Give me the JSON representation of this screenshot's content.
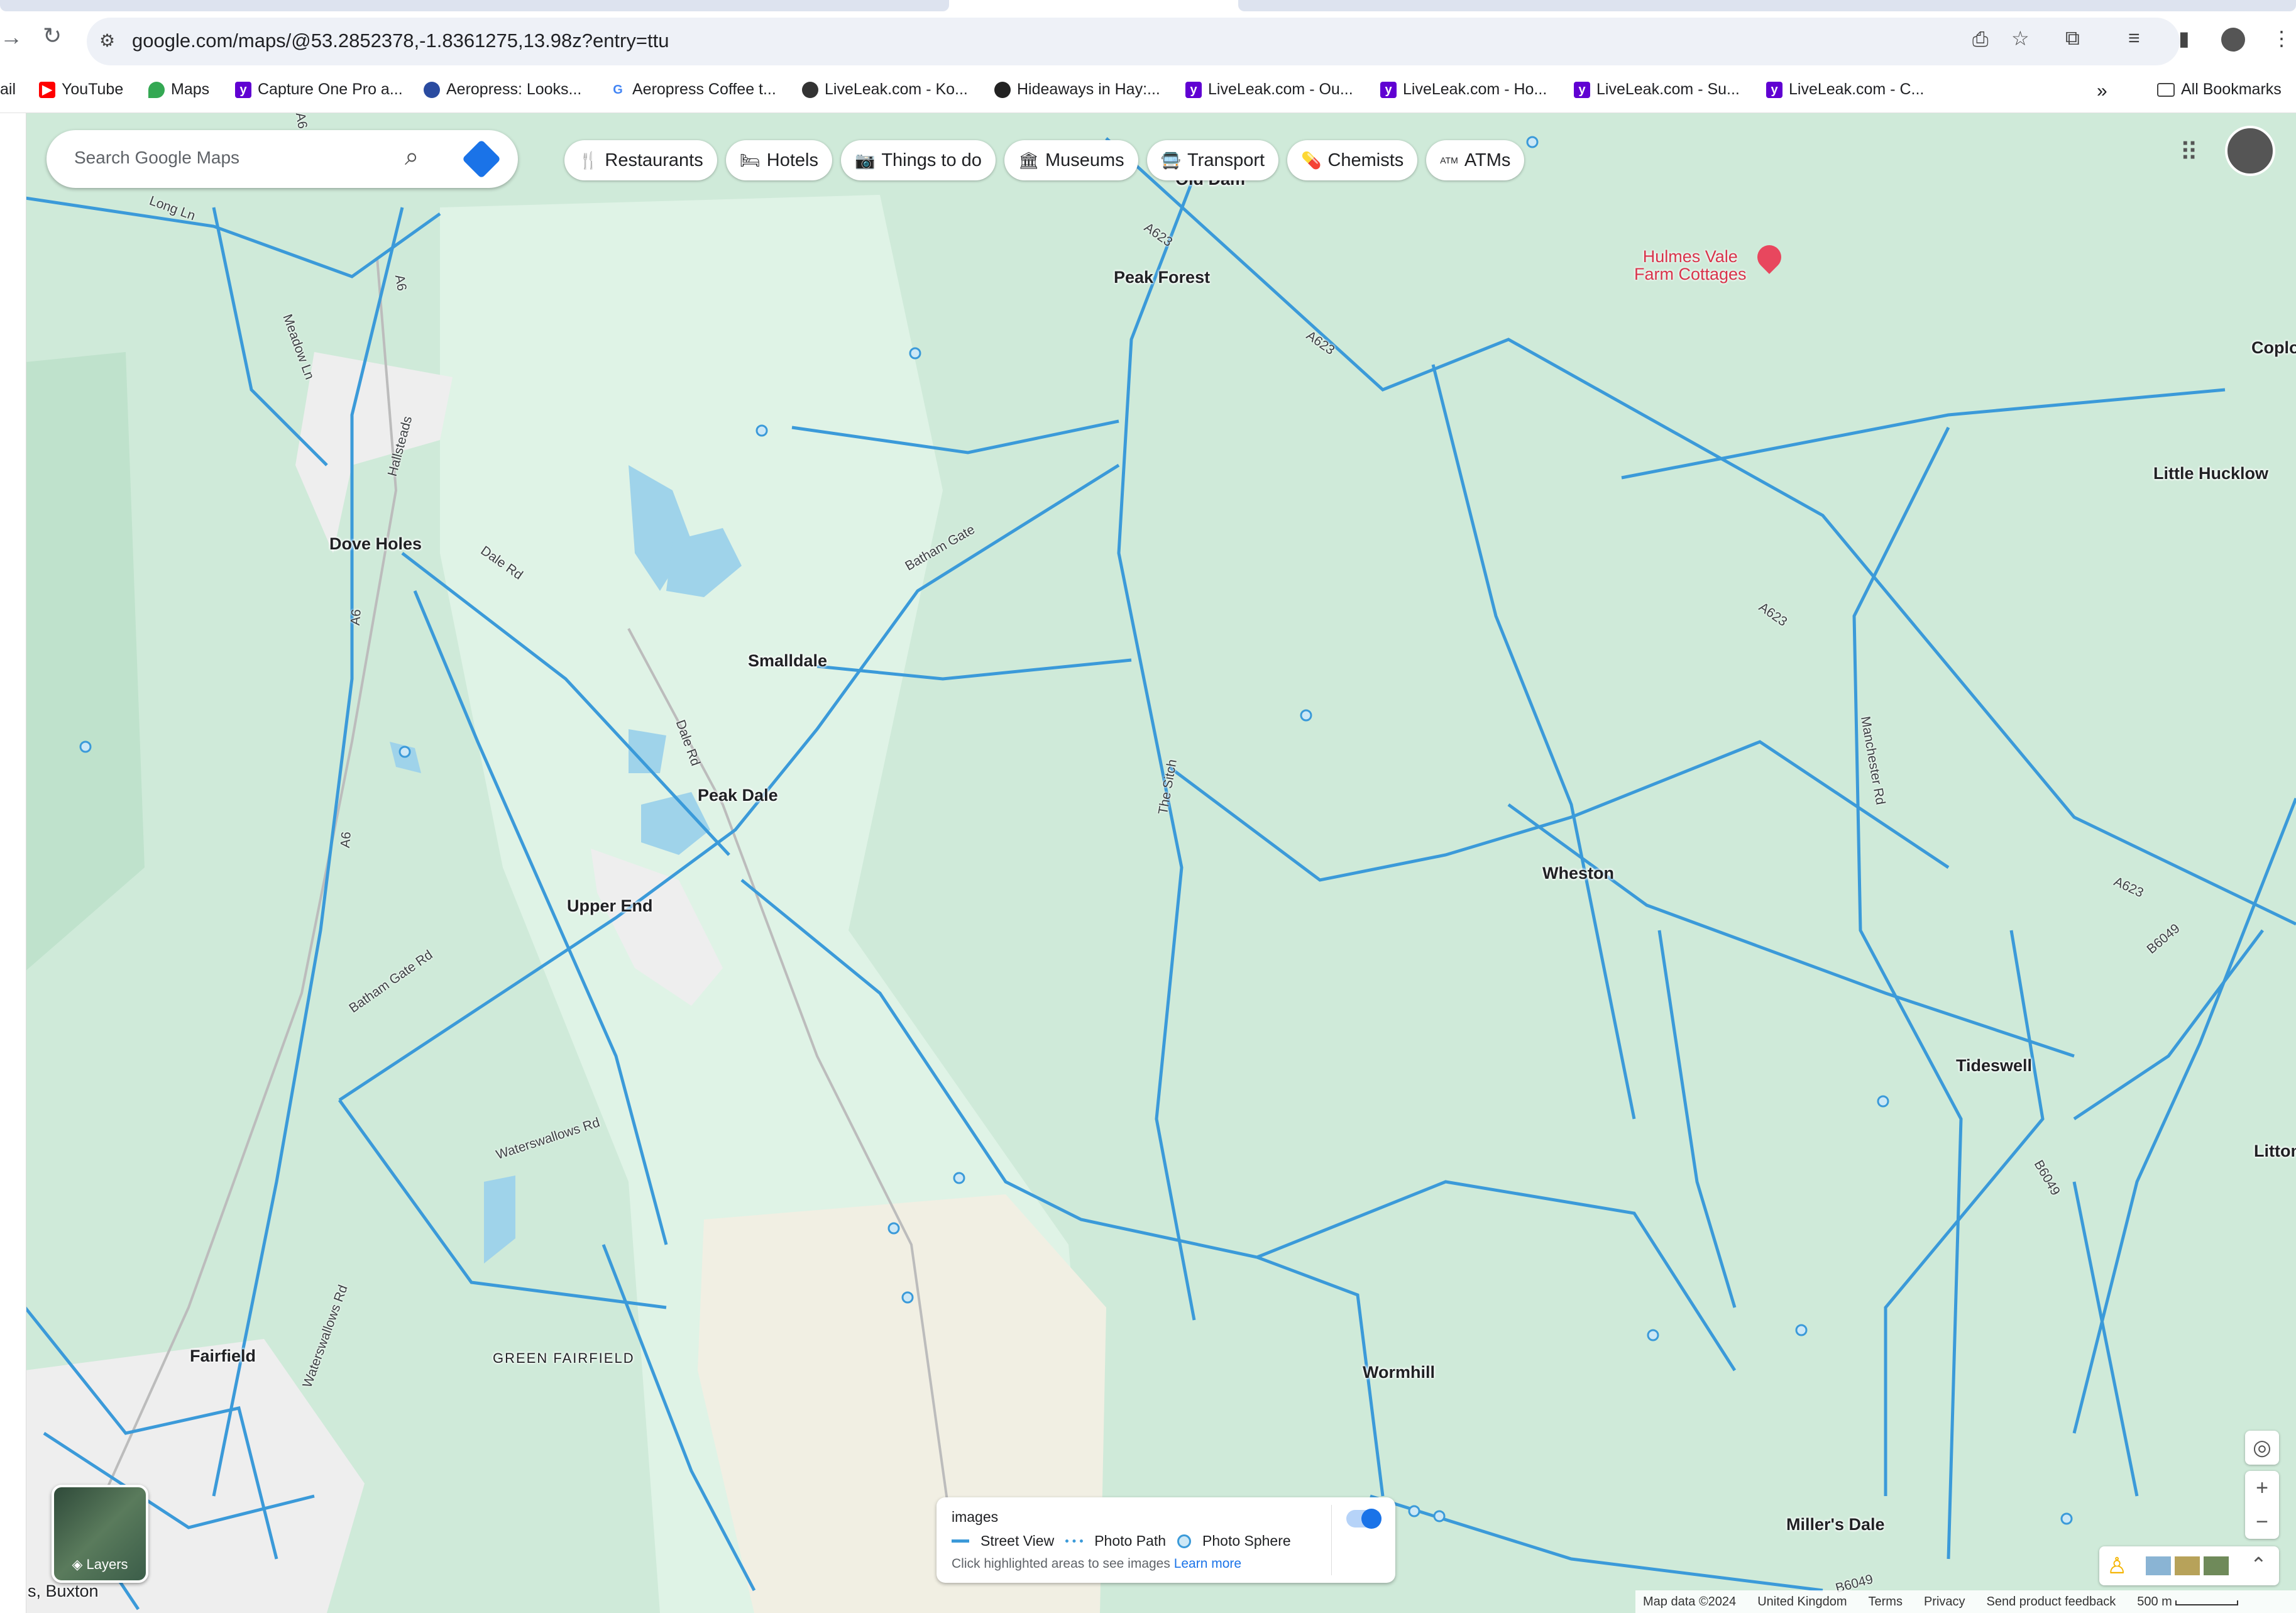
{
  "browser": {
    "url": "google.com/maps/@53.2852378,-1.8361275,13.98z?entry=ttu",
    "nav_forward_icon": "arrow-right",
    "reload_icon": "reload"
  },
  "bookmarks": {
    "items": [
      {
        "label": "ail",
        "icon": "truncated"
      },
      {
        "label": "YouTube",
        "icon": "youtube-icon",
        "color": "#ff0000"
      },
      {
        "label": "Maps",
        "icon": "maps-pin-icon",
        "color": "#34a853"
      },
      {
        "label": "Capture One Pro a...",
        "icon": "yahoo-icon",
        "color": "#6001d2"
      },
      {
        "label": "Aeropress: Looks...",
        "icon": "aeropress-icon",
        "color": "#2a4ba0"
      },
      {
        "label": "Aeropress Coffee t...",
        "icon": "google-icon",
        "color": "#4285f4"
      },
      {
        "label": "LiveLeak.com - Ko...",
        "icon": "liveleak-icon",
        "color": "#333333"
      },
      {
        "label": "Hideaways in Hay:...",
        "icon": "hideaways-icon",
        "color": "#222222"
      },
      {
        "label": "LiveLeak.com - Ou...",
        "icon": "yahoo-icon",
        "color": "#6001d2"
      },
      {
        "label": "LiveLeak.com - Ho...",
        "icon": "yahoo-icon",
        "color": "#6001d2"
      },
      {
        "label": "LiveLeak.com - Su...",
        "icon": "yahoo-icon",
        "color": "#6001d2"
      },
      {
        "label": "LiveLeak.com - C...",
        "icon": "yahoo-icon",
        "color": "#6001d2"
      }
    ],
    "overflow": "»",
    "all_bookmarks": "All Bookmarks"
  },
  "search": {
    "placeholder": "Search Google Maps"
  },
  "chips": [
    {
      "label": "Restaurants",
      "icon": "fork-knife-icon",
      "glyph": "🍴"
    },
    {
      "label": "Hotels",
      "icon": "bed-icon",
      "glyph": "🛏"
    },
    {
      "label": "Things to do",
      "icon": "camera-icon",
      "glyph": "📷"
    },
    {
      "label": "Museums",
      "icon": "museum-icon",
      "glyph": "🏛"
    },
    {
      "label": "Transport",
      "icon": "bus-icon",
      "glyph": "🚍"
    },
    {
      "label": "Chemists",
      "icon": "pharmacy-icon",
      "glyph": "💊"
    },
    {
      "label": "ATMs",
      "icon": "atm-icon",
      "glyph": "ATM"
    }
  ],
  "places": {
    "dove_holes": "Dove Holes",
    "peak_forest": "Peak Forest",
    "old_dam": "Old Dam",
    "smalldale": "Smalldale",
    "peak_dale": "Peak Dale",
    "upper_end": "Upper End",
    "wheston": "Wheston",
    "tideswell": "Tideswell",
    "little_hucklow": "Little Hucklow",
    "coplow": "Coplo",
    "litton": "Litton",
    "fairfield": "Fairfield",
    "green_fairfield": "GREEN FAIRFIELD",
    "wormhill": "Wormhill",
    "millers_dale": "Miller's Dale",
    "buxton": "s, Buxton"
  },
  "poi": {
    "hulmes_vale": "Hulmes Vale\nFarm Cottages"
  },
  "roads": {
    "a623_1": "A623",
    "a623_2": "A623",
    "a623_3": "A623",
    "a623_4": "A623",
    "a6_1": "A6",
    "a6_2": "A6",
    "a6_3": "A6",
    "a6_4": "A6",
    "b6049_1": "B6049",
    "b6049_2": "B6049",
    "b6049_3": "B6049",
    "long_ln": "Long Ln",
    "meadow_ln": "Meadow Ln",
    "hallsteads": "Hallsteads",
    "dale_rd_1": "Dale Rd",
    "dale_rd_2": "Dale Rd",
    "batham_gate": "Batham Gate",
    "batham_gate_rd": "Batham Gate Rd",
    "the_sitch": "The Sitch",
    "manchester_rd": "Manchester Rd",
    "waterswallows_rd_1": "Waterswallows Rd",
    "waterswallows_rd_2": "Waterswallows Rd"
  },
  "layers": {
    "label": "Layers"
  },
  "street_view_panel": {
    "title": "images",
    "legend_street_view": "Street View",
    "legend_photo_path": "Photo Path",
    "legend_photo_sphere": "Photo Sphere",
    "hint": "Click highlighted areas to see images",
    "learn_more": "Learn more",
    "toggle_on": true
  },
  "footer": {
    "map_data": "Map data ©2024",
    "region": "United Kingdom",
    "terms": "Terms",
    "privacy": "Privacy",
    "feedback": "Send product feedback",
    "scale": "500 m"
  },
  "colors": {
    "map_bg": "#cfead9",
    "map_light": "#dff3e6",
    "road_blue": "#3b9ad9",
    "brand_blue": "#1a73e8",
    "poi_red": "#d8334a"
  }
}
